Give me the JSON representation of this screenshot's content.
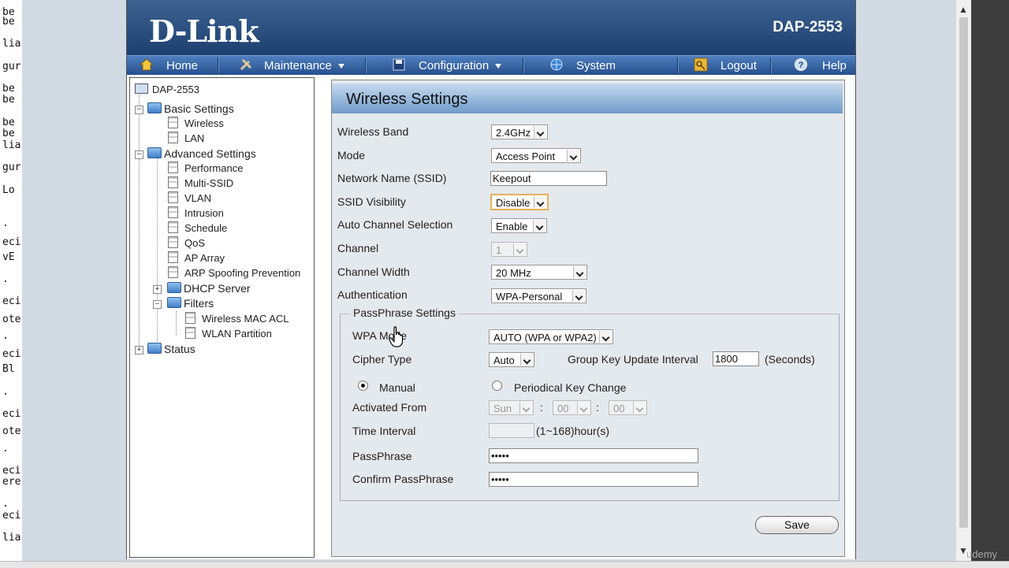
{
  "left_strip": [
    "be",
    "be",
    "lia",
    "gur",
    "be",
    "be",
    "be",
    "be",
    "lia",
    "gur",
    "Lo",
    ".",
    "eci",
    "vE",
    ".",
    "eci",
    "ote",
    ".",
    "eci",
    "Bl",
    ".",
    "eci",
    "ote",
    ".",
    "eci",
    "ere",
    ".",
    "eci",
    "lia"
  ],
  "header": {
    "logo": "D-Link",
    "model": "DAP-2553"
  },
  "nav": {
    "home": "Home",
    "maintenance": "Maintenance",
    "configuration": "Configuration",
    "system": "System",
    "logout": "Logout",
    "help": "Help"
  },
  "tree": {
    "root": "DAP-2553",
    "basic": "Basic Settings",
    "wireless": "Wireless",
    "lan": "LAN",
    "advanced": "Advanced Settings",
    "performance": "Performance",
    "multi_ssid": "Multi-SSID",
    "vlan": "VLAN",
    "intrusion": "Intrusion",
    "schedule": "Schedule",
    "qos": "QoS",
    "ap_array": "AP Array",
    "arp": "ARP Spoofing Prevention",
    "dhcp": "DHCP Server",
    "filters": "Filters",
    "wmac": "Wireless MAC ACL",
    "wlan_partition": "WLAN Partition",
    "status": "Status"
  },
  "form": {
    "title": "Wireless Settings",
    "wireless_band_label": "Wireless Band",
    "wireless_band": "2.4GHz",
    "mode_label": "Mode",
    "mode": "Access Point",
    "ssid_label": "Network Name (SSID)",
    "ssid": "Keepout",
    "visibility_label": "SSID Visibility",
    "visibility": "Disable",
    "auto_channel_label": "Auto Channel Selection",
    "auto_channel": "Enable",
    "channel_label": "Channel",
    "channel": "1",
    "channel_width_label": "Channel Width",
    "channel_width": "20 MHz",
    "auth_label": "Authentication",
    "auth": "WPA-Personal",
    "passphrase_settings": "PassPhrase Settings",
    "wpa_mode_label": "WPA Mode",
    "wpa_mode": "AUTO (WPA or WPA2)",
    "cipher_label": "Cipher Type",
    "cipher": "Auto",
    "group_key_label": "Group Key Update Interval",
    "group_key": "1800",
    "seconds": "(Seconds)",
    "manual": "Manual",
    "periodical": "Periodical Key Change",
    "activated_label": "Activated From",
    "day": "Sun",
    "hour": "00",
    "minute": "00",
    "colon": ":",
    "time_interval_label": "Time Interval",
    "time_interval_unit": "(1~168)hour(s)",
    "passphrase_label": "PassPhrase",
    "passphrase": "•••••",
    "confirm_label": "Confirm PassPhrase",
    "confirm": "•••••",
    "save": "Save"
  },
  "watermark": "udemy",
  "colors": {
    "header": "#1c3f70",
    "nav": "#264f8c",
    "content_bg": "#e4e9ee",
    "focus": "#e6b05a"
  }
}
